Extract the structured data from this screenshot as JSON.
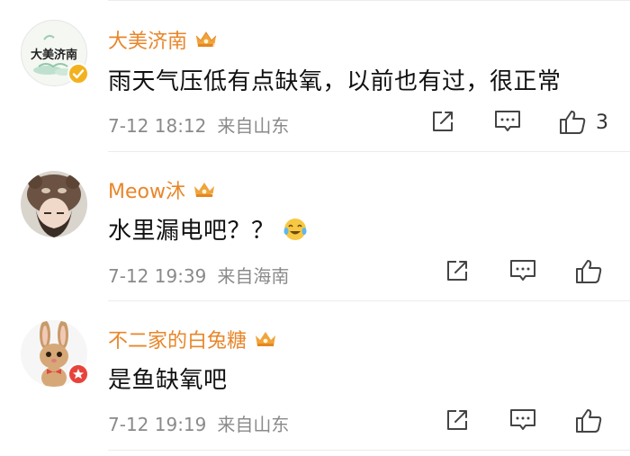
{
  "comments": [
    {
      "username": "大美济南",
      "avatar_icon": "da-mei-ji-nan-logo-avatar",
      "avatar_text": "大美济南",
      "text": "雨天气压低有点缺氧，以前也有过，很正常",
      "time": "7-12 18:12",
      "location": "来自山东",
      "likes": "3"
    },
    {
      "username": "Meow沐",
      "avatar_icon": "girl-with-bear-hat-avatar",
      "text": "水里漏电吧？？",
      "emoji": "laughing-crying-emoji",
      "time": "7-12 19:39",
      "location": "来自海南",
      "likes": ""
    },
    {
      "username": "不二家的白兔糖",
      "avatar_icon": "bunny-avatar",
      "text": "是鱼缺氧吧",
      "time": "7-12 19:19",
      "location": "来自山东",
      "likes": ""
    }
  ],
  "colors": {
    "username": "#e8862a",
    "meta": "#8a8a8a",
    "verified_badge": "#f2b21f",
    "red_badge": "#e8433b"
  },
  "icons": {
    "share": "share-icon",
    "comment": "comment-icon",
    "like": "like-icon",
    "vip": "crown-icon"
  }
}
